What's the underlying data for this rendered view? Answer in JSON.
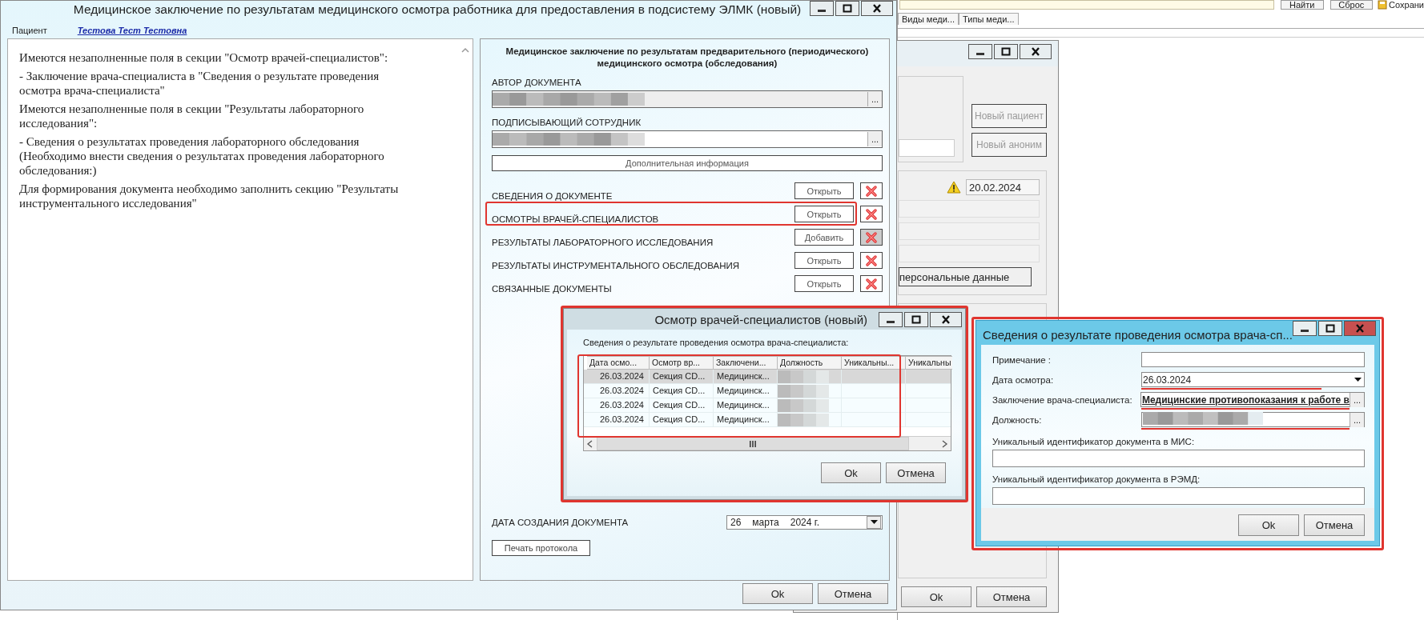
{
  "background_app": {
    "buttons": [
      "Найти",
      "Сброс"
    ],
    "save_button": "Сохрани",
    "tabs": [
      {
        "label": "Виды меди...",
        "selected": false
      },
      {
        "label": "Типы меди...",
        "selected": false
      }
    ]
  },
  "patient_window": {
    "buttons": [
      {
        "label": "Новый пациент",
        "disabled": true
      },
      {
        "label": "Новый аноним",
        "disabled": true
      }
    ],
    "date": "20.02.2024",
    "personal_data_button": "персональные данные",
    "footer_buttons": [
      "Ok",
      "Отмена"
    ]
  },
  "main_window": {
    "title": "Медицинское заключение по результатам медицинского осмотра работника для предоставления в подсистему ЭЛМК (новый)",
    "patient_label": "Пациент",
    "patient_name": "Тестова Тест Тестовна",
    "messages": [
      "Имеются незаполненные поля в секции \"Осмотр врачей-специалистов\":",
      "- Заключение врача-специалиста в \"Сведения о результате проведения осмотра врача-специалиста\"",
      "Имеются незаполненные поля в секции \"Результаты лабораторного исследования\":",
      "- Сведения о результатах проведения лабораторного обследования (Необходимо внести сведения о результатах проведения лабораторного обследования:)",
      "Для формирования документа необходимо заполнить секцию \"Результаты инструментального исследования\""
    ],
    "form": {
      "title": "Медицинское заключение по результатам предварительного (периодического) медицинского осмотра (обследования)",
      "author_label": "АВТОР ДОКУМЕНТА",
      "author_browse": "...",
      "signer_label": "ПОДПИСЫВАЮЩИЙ СОТРУДНИК",
      "signer_browse": "...",
      "additional_info_button": "Дополнительная информация",
      "sections": [
        {
          "label": "СВЕДЕНИЯ О ДОКУМЕНТЕ",
          "action": "Открыть",
          "highlighted": false,
          "delete_disabled": false
        },
        {
          "label": "ОСМОТРЫ ВРАЧЕЙ-СПЕЦИАЛИСТОВ",
          "action": "Открыть",
          "highlighted": true,
          "delete_disabled": false
        },
        {
          "label": "РЕЗУЛЬТАТЫ ЛАБОРАТОРНОГО ИССЛЕДОВАНИЯ",
          "action": "Добавить",
          "highlighted": false,
          "delete_disabled": true
        },
        {
          "label": "РЕЗУЛЬТАТЫ ИНСТРУМЕНТАЛЬНОГО ОБСЛЕДОВАНИЯ",
          "action": "Открыть",
          "highlighted": false,
          "delete_disabled": false
        },
        {
          "label": "СВЯЗАННЫЕ ДОКУМЕНТЫ",
          "action": "Открыть",
          "highlighted": false,
          "delete_disabled": false
        }
      ],
      "creation_date_label": "ДАТА СОЗДАНИЯ ДОКУМЕНТА",
      "creation_date": {
        "day": "26",
        "month": "марта",
        "year": "2024 г."
      },
      "print_button": "Печать протокола"
    },
    "footer_buttons": [
      "Ok",
      "Отмена"
    ]
  },
  "exam_dialog": {
    "title": "Осмотр врачей-специалистов (новый)",
    "highlighted": true,
    "caption": "Сведения о результате проведения осмотра врача-специалиста:",
    "table": {
      "highlighted": true,
      "columns": [
        "Дата осмо...",
        "Осмотр вр...",
        "Заключени...",
        "Должность",
        "Уникальны...",
        "Уникальны"
      ],
      "rows": [
        {
          "cells": [
            "26.03.2024",
            "Секция CD...",
            "Медицинск..."
          ],
          "selected": true
        },
        {
          "cells": [
            "26.03.2024",
            "Секция CD...",
            "Медицинск..."
          ],
          "selected": false
        },
        {
          "cells": [
            "26.03.2024",
            "Секция CD...",
            "Медицинск..."
          ],
          "selected": false
        },
        {
          "cells": [
            "26.03.2024",
            "Секция CD...",
            "Медицинск..."
          ],
          "selected": false
        }
      ]
    },
    "footer_buttons": [
      "Ok",
      "Отмена"
    ]
  },
  "result_dialog": {
    "title": "Сведения о результате проведения осмотра врача-сп...",
    "highlighted": true,
    "fields": [
      {
        "kind": "text",
        "label": "Примечание :",
        "marked": false
      },
      {
        "kind": "date",
        "label": "Дата осмотра:",
        "value": "26.03.2024",
        "marked": true
      },
      {
        "kind": "lookup",
        "label": "Заключение врача-специалиста:",
        "value": "Медицинские противопоказания к работе в",
        "browse": "...",
        "marked": true
      },
      {
        "kind": "lookup_redacted",
        "label": "Должность:",
        "browse": "...",
        "marked": true
      }
    ],
    "wide_fields": [
      {
        "label": "Уникальный идентификатор документа в МИС:"
      },
      {
        "label": "Уникальный идентификатор документа в РЭМД:"
      }
    ],
    "footer_buttons": [
      "Ok",
      "Отмена"
    ]
  }
}
